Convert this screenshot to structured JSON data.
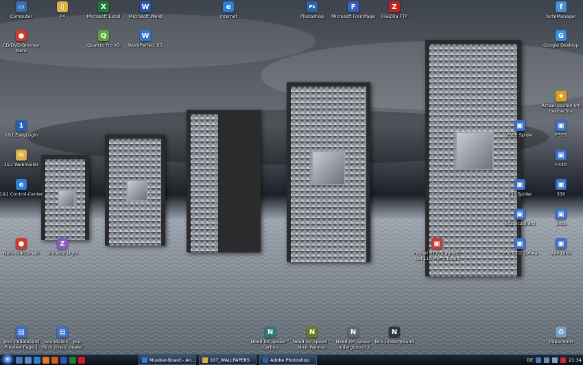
{
  "desktop": {
    "icons": [
      {
        "label": "Computer",
        "icon": "computer-icon",
        "color": "#3a6fb0",
        "sym": "▭"
      },
      {
        "label": "P4",
        "icon": "folder-icon",
        "color": "#d9b04a",
        "sym": "▯"
      },
      {
        "label": "Microsoft Excel",
        "icon": "excel-icon",
        "color": "#1f7a3a",
        "sym": "X"
      },
      {
        "label": "Microsoft Word",
        "icon": "word-icon",
        "color": "#2b56b0",
        "sym": "W"
      },
      {
        "label": "Internet",
        "icon": "internet-explorer-icon",
        "color": "#2c7fd8",
        "sym": "e"
      },
      {
        "label": "Photoshop",
        "icon": "photoshop-icon",
        "color": "#2a64a8",
        "sym": "Ps"
      },
      {
        "label": "Microsoft FrontPage",
        "icon": "frontpage-icon",
        "color": "#3a5fc0",
        "sym": "F"
      },
      {
        "label": "FileZilla FTP",
        "icon": "filezilla-icon",
        "color": "#c42020",
        "sym": "Z"
      },
      {
        "label": "forteManager",
        "icon": "fortemanager-icon",
        "color": "#4a8fd0",
        "sym": "f"
      },
      {
        "label": "CD/DVD-Brenner Nero",
        "icon": "nero-icon",
        "color": "#d03a2a",
        "sym": "●"
      },
      {
        "label": "Quattro Pro X3",
        "icon": "quattro-pro-icon",
        "color": "#5aa83a",
        "sym": "Q"
      },
      {
        "label": "WordPerfect X3",
        "icon": "wordperfect-icon",
        "color": "#2f7ad0",
        "sym": "W"
      },
      {
        "label": "Google Desktop",
        "icon": "google-desktop-icon",
        "color": "#3a8fe0",
        "sym": "G"
      },
      {
        "label": "Artikel kaufen Ich beobachte",
        "icon": "ebay-shortcut-icon",
        "color": "#d4a020",
        "sym": "★"
      },
      {
        "label": "1&1 EasyLogin",
        "icon": "easylogin-icon",
        "color": "#2a5fb0",
        "sym": "1"
      },
      {
        "label": "1&1 Webmailer",
        "icon": "webmailer-icon",
        "color": "#d9b04a",
        "sym": "✉"
      },
      {
        "label": "1&1 Control-Center",
        "icon": "control-center-icon",
        "color": "#2c7fd8",
        "sym": "e"
      },
      {
        "label": "Nero StartSmart",
        "icon": "nero-startsmart-icon",
        "color": "#d03a2a",
        "sym": "●"
      },
      {
        "label": "sinnezip Light",
        "icon": "zip-archive-icon",
        "color": "#8a5ac0",
        "sym": "Z"
      },
      {
        "label": "F355 Spider",
        "icon": "image-file-icon",
        "color": "#3a70c8",
        "sym": "▣"
      },
      {
        "label": "F355",
        "icon": "image-file-icon",
        "color": "#3a70c8",
        "sym": "▣"
      },
      {
        "label": "F430",
        "icon": "image-file-icon",
        "color": "#3a70c8",
        "sym": "▣"
      },
      {
        "label": "330 Spider",
        "icon": "image-file-icon",
        "color": "#3a70c8",
        "sym": "▣"
      },
      {
        "label": "330",
        "icon": "image-file-icon",
        "color": "#3a70c8",
        "sym": "▣"
      },
      {
        "label": "612 Scaglietti",
        "icon": "image-file-icon",
        "color": "#3a70c8",
        "sym": "▣"
      },
      {
        "label": "Enzo",
        "icon": "image-file-icon",
        "color": "#3a70c8",
        "sym": "▣"
      },
      {
        "label": "Ferrari 612 Scaglietti red 118 Hvr 1 Kopie",
        "icon": "image-file-icon",
        "color": "#c83a3a",
        "sym": "▣"
      },
      {
        "label": "250 GTO 1964a",
        "icon": "image-file-icon",
        "color": "#3a70c8",
        "sym": "▣"
      },
      {
        "label": "246 Dino",
        "icon": "image-file-icon",
        "color": "#3a70c8",
        "sym": "▣"
      },
      {
        "label": "Your Pedalboard Preview Page 1",
        "icon": "document-icon",
        "color": "#3a70c8",
        "sym": "▤"
      },
      {
        "label": "Soundclick - you Rock music dealer",
        "icon": "document-icon",
        "color": "#3a70c8",
        "sym": "▤"
      },
      {
        "label": "Need for Speed™ Carbon",
        "icon": "nfs-carbon-icon",
        "color": "#2a7a7a",
        "sym": "N"
      },
      {
        "label": "Need for Speed™ Most Wanted",
        "icon": "nfs-most-wanted-icon",
        "color": "#6a7a20",
        "sym": "N"
      },
      {
        "label": "Need for Speed Underground 2",
        "icon": "nfs-underground-2-icon",
        "color": "#5a6a7a",
        "sym": "N"
      },
      {
        "label": "NFS Underground",
        "icon": "nfs-underground-icon",
        "color": "#30363e",
        "sym": "N"
      },
      {
        "label": "Papierkorb",
        "icon": "recycle-bin-icon",
        "color": "#7aa0c8",
        "sym": "♻"
      }
    ]
  },
  "taskbar": {
    "windows": [
      {
        "label": "Musiker-Board - An...",
        "icon": "internet-explorer-icon",
        "color": "#2c7fd8"
      },
      {
        "label": "107_WALLPAPERS",
        "icon": "folder-icon",
        "color": "#d9b04a"
      },
      {
        "label": "Adobe Photoshop",
        "icon": "photoshop-icon",
        "color": "#2a64a8"
      }
    ],
    "language": "DE",
    "clock": "21:34"
  }
}
